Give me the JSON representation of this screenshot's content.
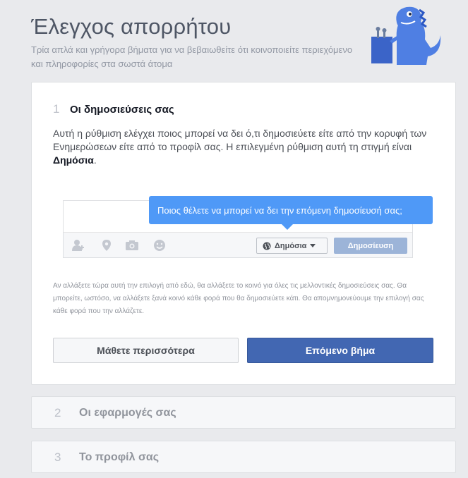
{
  "header": {
    "title": "Έλεγχος απορρήτου",
    "subtitle": "Τρία απλά και γρήγορα βήματα για να βεβαιωθείτε ότι κοινοποιείτε περιεχόμενο και πληροφορίες στα σωστά άτομα"
  },
  "step1": {
    "number": "1",
    "title": "Οι δημοσιεύσεις σας",
    "desc_text": "Αυτή η ρύθμιση ελέγχει ποιος μπορεί να δει ό,τι δημοσιεύετε είτε από την κορυφή των Ενημερώσεων είτε από το προφίλ σας. Η επιλεγμένη ρύθμιση αυτή τη στιγμή είναι ",
    "desc_bold": "Δημόσια",
    "desc_end": ".",
    "tooltip": "Ποιος θέλετε να μπορεί να δει την επόμενη δημοσίευσή σας;",
    "audience_label": "Δημόσια",
    "post_label": "Δημοσίευση",
    "note": "Αν αλλάξετε τώρα αυτή την επιλογή από εδώ, θα αλλάξετε το κοινό για όλες τις μελλοντικές δημοσιεύσεις σας. Θα μπορείτε, ωστόσο, να αλλάξετε ξανά κοινό κάθε φορά που θα δημοσιεύετε κάτι. Θα απομνημονεύουμε την επιλογή σας κάθε φορά που την αλλάζετε.",
    "learn_more": "Μάθετε περισσότερα",
    "next_step": "Επόμενο βήμα"
  },
  "step2": {
    "number": "2",
    "title": "Οι εφαρμογές σας"
  },
  "step3": {
    "number": "3",
    "title": "Το προφίλ σας"
  },
  "icons": [
    "tag-friends-icon",
    "location-icon",
    "camera-icon",
    "emoji-icon",
    "globe-icon"
  ],
  "colors": {
    "primary": "#4267b2",
    "tooltip": "#4f99f7",
    "dino": "#4f7fe3"
  }
}
